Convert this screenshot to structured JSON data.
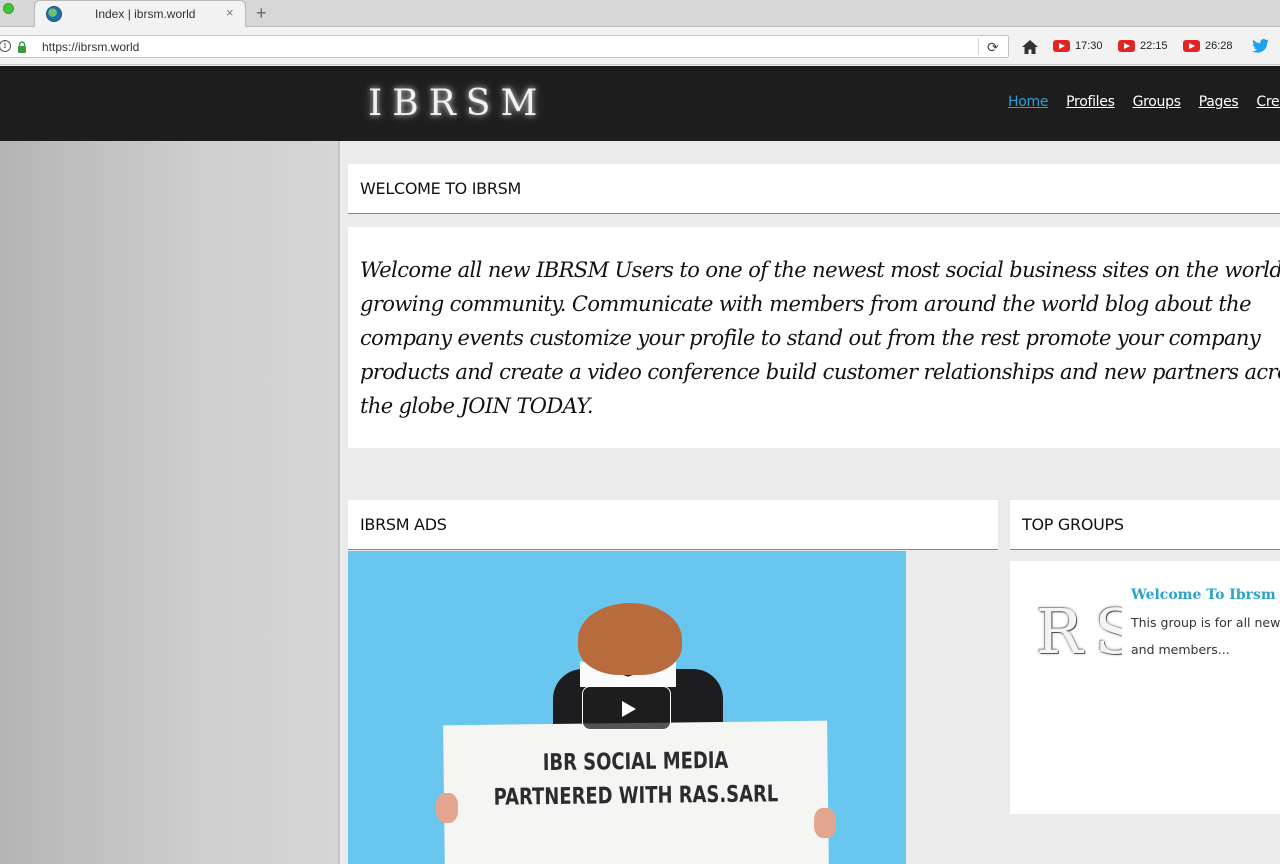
{
  "browser": {
    "tab_title": "Index | ibrsm.world",
    "tab_close": "×",
    "new_tab": "+",
    "url": "https://ibrsm.world",
    "info_glyph": "i",
    "reload_glyph": "⟳",
    "extensions": [
      {
        "icon": "youtube-icon",
        "time": "17:30"
      },
      {
        "icon": "youtube-icon",
        "time": "22:15"
      },
      {
        "icon": "youtube-icon",
        "time": "26:28"
      }
    ]
  },
  "site": {
    "logo": "IBRSM",
    "nav": [
      {
        "label": "Home",
        "active": true
      },
      {
        "label": "Profiles",
        "active": false
      },
      {
        "label": "Groups",
        "active": false
      },
      {
        "label": "Pages",
        "active": false
      },
      {
        "label": "Crea",
        "active": false
      }
    ],
    "accent_color": "#2b9fd1"
  },
  "welcome": {
    "heading": "WELCOME TO IBRSM",
    "text": "Welcome all new IBRSM Users to one of the newest most social business sites on the world growing community. Communicate with members from around the world blog about the company events customize your profile to stand out from the rest promote your company products and create a video conference build customer relationships and new partners across the globe JOIN TODAY."
  },
  "ads": {
    "heading": "IBRSM ADS",
    "video_sign_text": "IBR SOCIAL MEDIA PARTNERED WITH RAS.SARL"
  },
  "top_groups": {
    "heading": "TOP GROUPS",
    "thumb_text": "RS",
    "group_name": "Welcome To Ibrsm",
    "group_desc": "This group is for all new and members..."
  }
}
